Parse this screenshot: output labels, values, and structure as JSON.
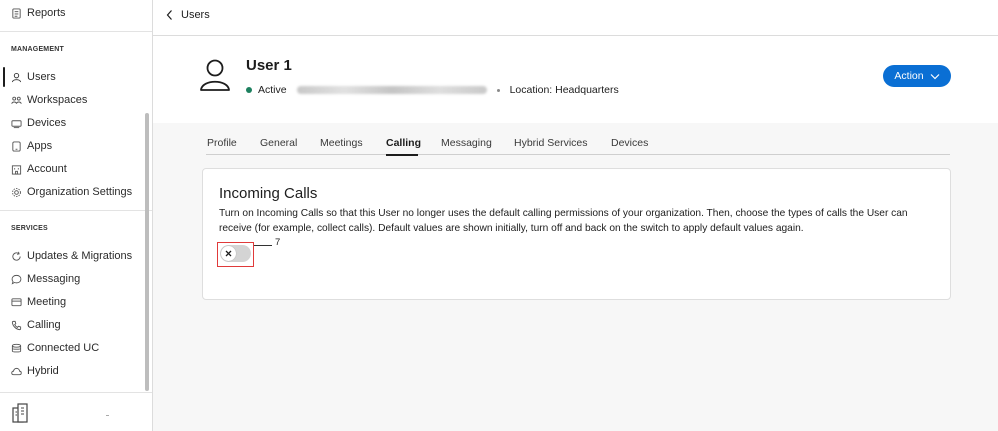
{
  "sidebar": {
    "top_item": {
      "label": "Reports",
      "icon": "reports-icon"
    },
    "sections": [
      {
        "title": "MANAGEMENT",
        "items": [
          {
            "label": "Users",
            "icon": "user-icon",
            "active": true
          },
          {
            "label": "Workspaces",
            "icon": "workspaces-icon"
          },
          {
            "label": "Devices",
            "icon": "devices-icon"
          },
          {
            "label": "Apps",
            "icon": "apps-icon"
          },
          {
            "label": "Account",
            "icon": "account-icon"
          },
          {
            "label": "Organization Settings",
            "icon": "gear-icon"
          }
        ]
      },
      {
        "title": "SERVICES",
        "items": [
          {
            "label": "Updates & Migrations",
            "icon": "refresh-icon"
          },
          {
            "label": "Messaging",
            "icon": "chat-bubble-icon"
          },
          {
            "label": "Meeting",
            "icon": "meeting-icon"
          },
          {
            "label": "Calling",
            "icon": "phone-icon"
          },
          {
            "label": "Connected UC",
            "icon": "stack-icon"
          },
          {
            "label": "Hybrid",
            "icon": "cloud-icon"
          }
        ]
      }
    ],
    "footer_icon": "building-icon"
  },
  "header": {
    "back_label": "Users"
  },
  "user": {
    "name": "User 1",
    "status": "Active",
    "location": "Location: Headquarters",
    "status_color": "#1d805f"
  },
  "action_button": {
    "label": "Action",
    "color": "#0a6fd4"
  },
  "tabs": [
    "Profile",
    "General",
    "Meetings",
    "Calling",
    "Messaging",
    "Hybrid Services",
    "Devices"
  ],
  "active_tab": "Calling",
  "card": {
    "title": "Incoming Calls",
    "description": "Turn on Incoming Calls so that this User no longer uses the default calling permissions of your organization. Then, choose the types of calls the User can receive (for example, collect calls). Default values are shown initially, turn off and back on the switch to apply default values again.",
    "toggle_on": false
  },
  "callout": {
    "number": "7",
    "color": "#e03a3a"
  }
}
